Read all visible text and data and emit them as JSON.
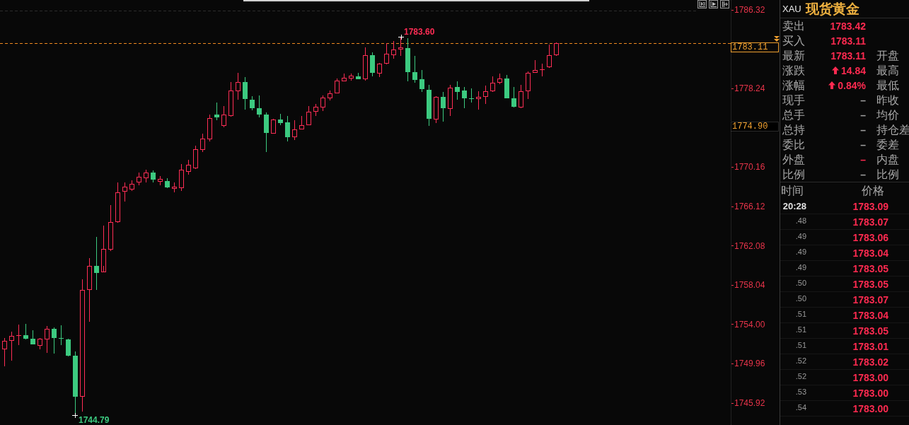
{
  "chart": {
    "high_label": "1783.60",
    "low_label": "1744.79",
    "price_axis": [
      "1786.32",
      "1778.24",
      "1770.16",
      "1766.12",
      "1762.08",
      "1758.04",
      "1754.00",
      "1749.96",
      "1745.92"
    ],
    "last_price_tag": "1783.11",
    "cursor_price_tag": "1774.90"
  },
  "quote": {
    "symbol": "XAU",
    "name": "现货黄金",
    "rows": [
      {
        "label": "卖出",
        "value": "1783.42",
        "color": "#ff2a50",
        "up": false
      },
      {
        "label": "买入",
        "value": "1783.11",
        "color": "#ff2a50",
        "up": false
      },
      {
        "label": "最新",
        "value": "1783.11",
        "color": "#ff2a50",
        "up": false,
        "right_label": "开盘"
      },
      {
        "label": "涨跌",
        "value": "14.84",
        "color": "#ff2a50",
        "up": true,
        "right_label": "最高"
      },
      {
        "label": "涨幅",
        "value": "0.84%",
        "color": "#ff2a50",
        "up": true,
        "right_label": "最低"
      },
      {
        "label": "现手",
        "value": "–",
        "color": "#a0a0a0",
        "up": false,
        "right_label": "昨收"
      },
      {
        "label": "总手",
        "value": "–",
        "color": "#a0a0a0",
        "up": false,
        "right_label": "均价"
      },
      {
        "label": "总持",
        "value": "–",
        "color": "#a0a0a0",
        "up": false,
        "right_label": "持仓差"
      },
      {
        "label": "委比",
        "value": "–",
        "color": "#a0a0a0",
        "up": false,
        "right_label": "委差"
      },
      {
        "label": "外盘",
        "value": "–",
        "color": "#ff2a50",
        "up": false,
        "right_label": "内盘"
      },
      {
        "label": "比例",
        "value": "–",
        "color": "#a0a0a0",
        "up": false,
        "right_label": "比例"
      }
    ]
  },
  "time_sales": {
    "columns": [
      "时间",
      "价格"
    ],
    "rows": [
      {
        "kind": "minute",
        "time": "20:28",
        "price": "1783.09"
      },
      {
        "kind": "second",
        "time": ".48",
        "price": "1783.07"
      },
      {
        "kind": "second",
        "time": ".49",
        "price": "1783.06"
      },
      {
        "kind": "second",
        "time": ".49",
        "price": "1783.04"
      },
      {
        "kind": "second",
        "time": ".49",
        "price": "1783.05"
      },
      {
        "kind": "second",
        "time": ".50",
        "price": "1783.05"
      },
      {
        "kind": "second",
        "time": ".50",
        "price": "1783.07"
      },
      {
        "kind": "second",
        "time": ".51",
        "price": "1783.04"
      },
      {
        "kind": "second",
        "time": ".51",
        "price": "1783.05"
      },
      {
        "kind": "second",
        "time": ".51",
        "price": "1783.01"
      },
      {
        "kind": "second",
        "time": ".52",
        "price": "1783.02"
      },
      {
        "kind": "second",
        "time": ".52",
        "price": "1783.00"
      },
      {
        "kind": "second",
        "time": ".53",
        "price": "1783.00"
      },
      {
        "kind": "second",
        "time": ".54",
        "price": "1783.00"
      }
    ]
  }
}
